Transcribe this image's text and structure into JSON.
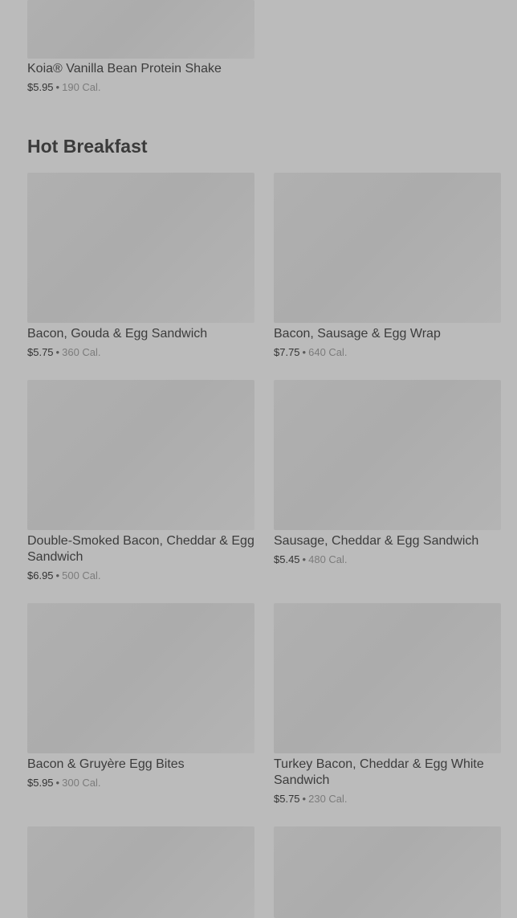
{
  "separator": "•",
  "top_item": {
    "name": "Koia® Vanilla Bean Protein Shake",
    "price": "$5.95",
    "calories": "190 Cal."
  },
  "section": {
    "title": "Hot Breakfast",
    "items": [
      {
        "name": "Bacon, Gouda & Egg Sandwich",
        "price": "$5.75",
        "calories": "360 Cal."
      },
      {
        "name": "Bacon, Sausage & Egg Wrap",
        "price": "$7.75",
        "calories": "640 Cal."
      },
      {
        "name": "Double-Smoked Bacon, Cheddar & Egg Sandwich",
        "price": "$6.95",
        "calories": "500 Cal."
      },
      {
        "name": "Sausage, Cheddar & Egg Sandwich",
        "price": "$5.45",
        "calories": "480 Cal."
      },
      {
        "name": "Bacon & Gruyère Egg Bites",
        "price": "$5.95",
        "calories": "300 Cal."
      },
      {
        "name": "Turkey Bacon, Cheddar & Egg White Sandwich",
        "price": "$5.75",
        "calories": "230 Cal."
      }
    ]
  }
}
